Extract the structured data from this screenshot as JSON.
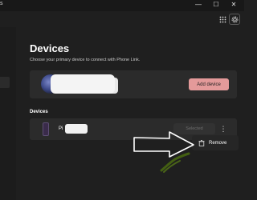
{
  "window": {
    "title_fragment": "s",
    "controls": {
      "minimize": "—",
      "maximize": "☐",
      "close": "✕"
    }
  },
  "page": {
    "title": "Devices",
    "subtitle": "Choose your primary device to connect with Phone Link."
  },
  "primary_device": {
    "add_device_label": "Add device"
  },
  "devices_section": {
    "label": "Devices",
    "items": [
      {
        "name_visible_prefix": "Pi",
        "select_label": "Selected",
        "more_label": "⋮"
      }
    ]
  },
  "context_menu": {
    "items": [
      {
        "label": "Remove",
        "icon": "trash-icon"
      }
    ]
  },
  "icons": {
    "apps": "apps-grid-icon",
    "settings": "gear-icon",
    "remove": "trash-icon"
  },
  "colors": {
    "background": "#1f1f1f",
    "card": "#2b2b2b",
    "accent_button": "#e49a9a",
    "annotation_arrow": "#ffffff",
    "annotation_scribble": "#4a6b10"
  }
}
